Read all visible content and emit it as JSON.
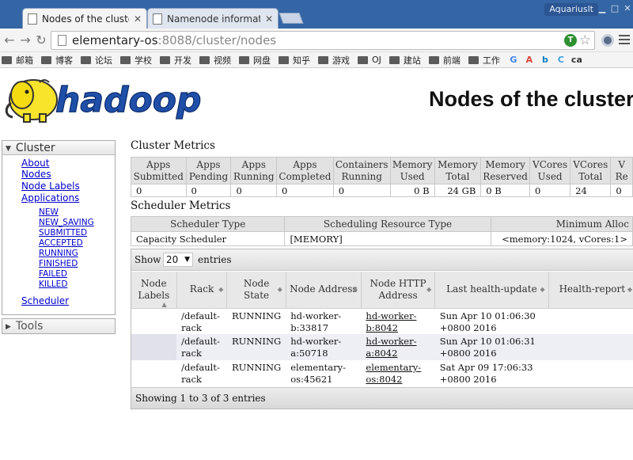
{
  "browser": {
    "tabs": [
      {
        "title": "Nodes of the cluster",
        "active": true
      },
      {
        "title": "Namenode information",
        "active": false
      }
    ],
    "user": "Aquariuslt",
    "url_host": "elementary-os",
    "url_port": ":8088",
    "url_path": "/cluster/nodes",
    "bookmarks": [
      {
        "label": "邮箱",
        "icon": "folder-icon"
      },
      {
        "label": "博客",
        "icon": "folder-icon"
      },
      {
        "label": "论坛",
        "icon": "folder-icon"
      },
      {
        "label": "学校",
        "icon": "folder-icon"
      },
      {
        "label": "开发",
        "icon": "folder-icon"
      },
      {
        "label": "视频",
        "icon": "folder-icon"
      },
      {
        "label": "网盘",
        "icon": "folder-icon"
      },
      {
        "label": "知乎",
        "icon": "folder-icon"
      },
      {
        "label": "游戏",
        "icon": "folder-icon"
      },
      {
        "label": "OJ",
        "icon": "folder-icon"
      },
      {
        "label": "建站",
        "icon": "folder-icon"
      },
      {
        "label": "前端",
        "icon": "folder-icon"
      },
      {
        "label": "工作",
        "icon": "folder-icon"
      }
    ],
    "bookmark_icons": [
      {
        "glyph": "G",
        "color": "#4285f4",
        "name": "google-icon"
      },
      {
        "glyph": "A",
        "color": "#db4437",
        "name": "app-a-icon"
      },
      {
        "glyph": "b",
        "color": "#0a7fc0",
        "name": "bing-icon"
      },
      {
        "glyph": "C",
        "color": "#3aa0e0",
        "name": "app-c-icon"
      },
      {
        "glyph": "ca",
        "color": "#333333",
        "name": "app-ca-icon"
      }
    ]
  },
  "header": {
    "logo_text": "hadoop",
    "title": "Nodes of the cluster"
  },
  "sidebar": {
    "cluster_label": "Cluster",
    "links": {
      "about": "About",
      "nodes": "Nodes",
      "node_labels": "Node Labels",
      "applications": "Applications",
      "scheduler": "Scheduler"
    },
    "app_states": [
      "NEW",
      "NEW_SAVING",
      "SUBMITTED",
      "ACCEPTED",
      "RUNNING",
      "FINISHED",
      "FAILED",
      "KILLED"
    ],
    "tools_label": "Tools"
  },
  "cluster_metrics": {
    "title": "Cluster Metrics",
    "headers": [
      [
        "Apps",
        "Submitted"
      ],
      [
        "Apps",
        "Pending"
      ],
      [
        "Apps",
        "Running"
      ],
      [
        "Apps",
        "Completed"
      ],
      [
        "Containers",
        "Running"
      ],
      [
        "Memory",
        "Used"
      ],
      [
        "Memory",
        "Total"
      ],
      [
        "Memory",
        "Reserved"
      ],
      [
        "VCores",
        "Used"
      ],
      [
        "VCores",
        "Total"
      ],
      [
        "V",
        "Re"
      ]
    ],
    "values": [
      "0",
      "0",
      "0",
      "0",
      "0",
      "0 B",
      "24 GB",
      "0 B",
      "0",
      "24",
      "0"
    ]
  },
  "scheduler_metrics": {
    "title": "Scheduler Metrics",
    "headers": [
      "Scheduler Type",
      "Scheduling Resource Type",
      "Minimum Alloc"
    ],
    "values": [
      "Capacity Scheduler",
      "[MEMORY]",
      "<memory:1024, vCores:1>"
    ]
  },
  "nodes_table": {
    "show_label": "Show",
    "page_size": "20",
    "entries_label": "entries",
    "headers": [
      [
        "Node",
        "Labels"
      ],
      [
        "Rack"
      ],
      [
        "Node",
        "State"
      ],
      [
        "Node Address"
      ],
      [
        "Node HTTP",
        "Address"
      ],
      [
        "Last health-update"
      ],
      [
        "Health-report"
      ]
    ],
    "rows": [
      {
        "labels": "",
        "rack": [
          "/default-",
          "rack"
        ],
        "state": "RUNNING",
        "address": [
          "hd-worker-",
          "b:33817"
        ],
        "http": [
          "hd-worker-",
          "b:8042"
        ],
        "health_update": [
          "Sun Apr 10 01:06:30",
          "+0800 2016"
        ],
        "report": ""
      },
      {
        "labels": "",
        "rack": [
          "/default-",
          "rack"
        ],
        "state": "RUNNING",
        "address": [
          "hd-worker-",
          "a:50718"
        ],
        "http": [
          "hd-worker-",
          "a:8042"
        ],
        "health_update": [
          "Sun Apr 10 01:06:31",
          "+0800 2016"
        ],
        "report": ""
      },
      {
        "labels": "",
        "rack": [
          "/default-",
          "rack"
        ],
        "state": "RUNNING",
        "address": [
          "elementary-",
          "os:45621"
        ],
        "http": [
          "elementary-",
          "os:8042"
        ],
        "health_update": [
          "Sat Apr 09 17:06:33",
          "+0800 2016"
        ],
        "report": ""
      }
    ],
    "footer": "Showing 1 to 3 of 3 entries"
  }
}
